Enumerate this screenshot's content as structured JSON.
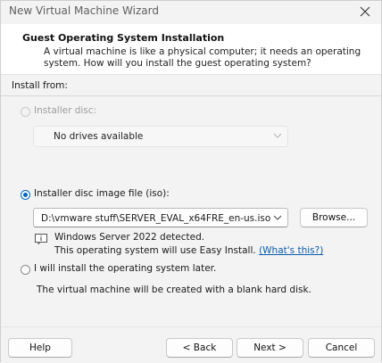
{
  "window": {
    "title": "New Virtual Machine Wizard"
  },
  "header": {
    "title": "Guest Operating System Installation",
    "subtitle": "A virtual machine is like a physical computer; it needs an operating system. How will you install the guest operating system?"
  },
  "install_from": {
    "label": "Install from:",
    "installer_disc": {
      "label": "Installer disc:",
      "selected": false,
      "enabled": false,
      "dropdown_value": "No drives available"
    },
    "iso": {
      "label": "Installer disc image file (iso):",
      "selected": true,
      "value": "D:\\vmware stuff\\SERVER_EVAL_x64FRE_en-us.iso",
      "browse_label": "Browse..."
    },
    "detection": {
      "line1": "Windows Server 2022 detected.",
      "line2_prefix": "This operating system will use Easy Install.",
      "link": "(What's this?)"
    },
    "later": {
      "label": "I will install the operating system later.",
      "selected": false,
      "note": "The virtual machine will be created with a blank hard disk."
    }
  },
  "footer": {
    "help": "Help",
    "back": "< Back",
    "next": "Next >",
    "cancel": "Cancel"
  },
  "colors": {
    "accent": "#0067c0",
    "link": "#0b5cad",
    "header_bg": "#ffffff",
    "window_bg": "#f3f3f3"
  },
  "icons": {
    "close": "close-icon",
    "chevron": "chevron-down-icon",
    "info": "info-icon"
  }
}
